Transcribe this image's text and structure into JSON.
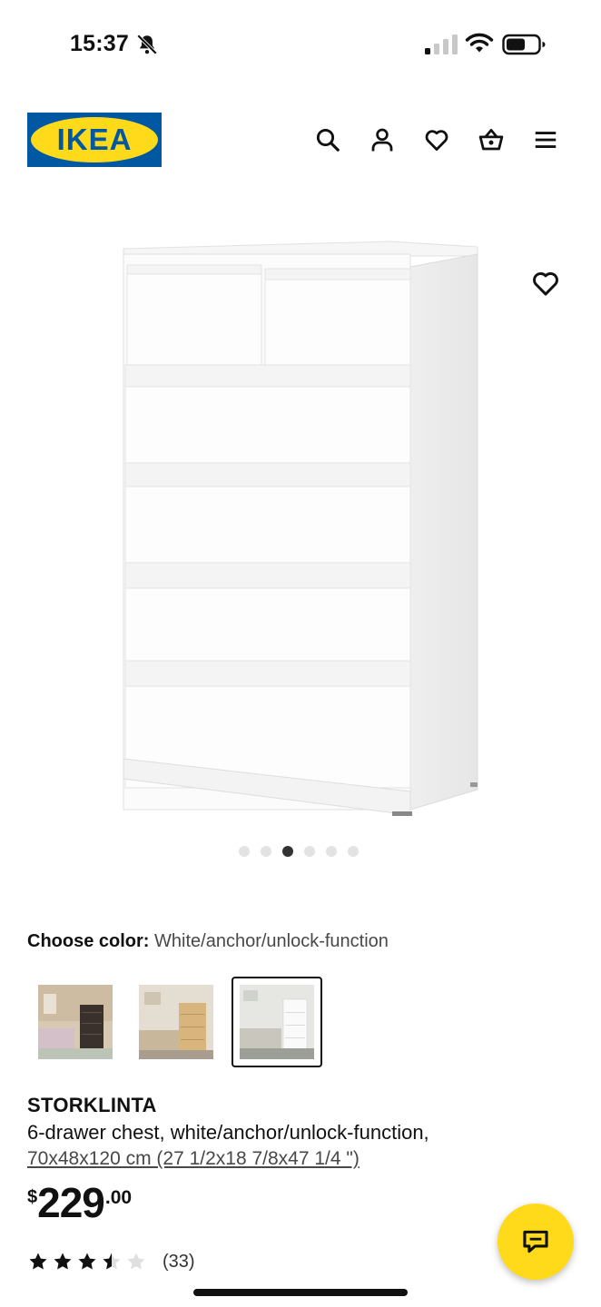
{
  "status_bar": {
    "time": "15:37"
  },
  "header": {
    "logo_text": "IKEA",
    "icons": [
      "search-icon",
      "account-icon",
      "heart-icon",
      "basket-icon",
      "menu-icon"
    ]
  },
  "gallery": {
    "image_count": 6,
    "active_index": 2
  },
  "colors": {
    "brand_blue": "#0058A3",
    "brand_yellow": "#FFDA1A"
  },
  "color_chooser": {
    "label": "Choose color:",
    "value": "White/anchor/unlock-function",
    "swatches": [
      {
        "name": "Black-brown",
        "selected": false
      },
      {
        "name": "Oak effect",
        "selected": false
      },
      {
        "name": "White",
        "selected": true
      }
    ]
  },
  "product": {
    "name": "STORKLINTA",
    "description": "6-drawer chest, white/anchor/unlock-function,",
    "measurements": "70x48x120 cm (27 1/2x18 7/8x47 1/4 \")",
    "price_currency": "$",
    "price_integer": "229",
    "price_decimal": ".00",
    "rating": 3.5,
    "rating_max": 5,
    "review_count": "(33)"
  }
}
